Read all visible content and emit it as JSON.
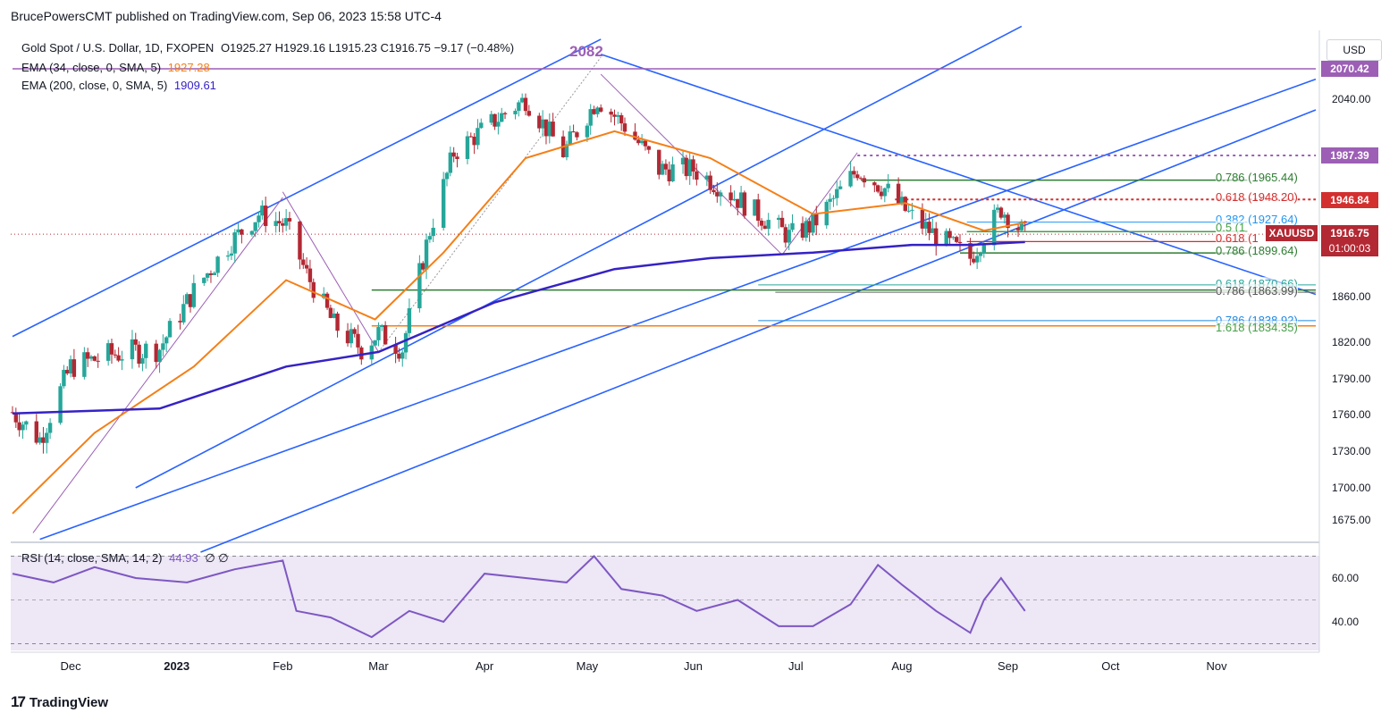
{
  "header": {
    "publisher_line": "BrucePowersCMT published on TradingView.com, Sep 06, 2023 15:58 UTC-4"
  },
  "legend": {
    "symbol": "Gold Spot / U.S. Dollar, 1D, FXOPEN",
    "ohlc": "O1925.27  H1929.16  L1915.23  C1916.75  −9.17 (−0.48%)",
    "ema34_label": "EMA (34, close, 0, SMA, 5)",
    "ema34_value": "1927.28",
    "ema200_label": "EMA (200, close, 0, SMA, 5)",
    "ema200_value": "1909.61",
    "rsi_label": "RSI (14, close, SMA, 14, 2)",
    "rsi_value": "44.93",
    "rsi_extra": "∅ ∅"
  },
  "peak_label": "2082",
  "currency": "USD",
  "price_tags": {
    "resistance_high": "2070.42",
    "dotted_high": "1987.39",
    "red_level": "1946.84",
    "last_price": "1916.75",
    "symbol": "XAUUSD",
    "countdown": "01:00:03"
  },
  "fib_labels": {
    "f1": "0.786 (1965.44)",
    "f2": "0.618 (1948.20)",
    "f3": "0.382 (1927.64)",
    "f4": "0.5 (1",
    "f5": "0.618 (1",
    "f6": "0.786 (1899.64)",
    "f7": "0.618 (1870.66)",
    "f8": "0.786 (1863.99)",
    "f9": "0.786 (1838.92)",
    "f10": "1.618 (1834.35)"
  },
  "footer": {
    "brand": "TradingView",
    "logo": "17"
  },
  "colors": {
    "up": "#26a69a",
    "down": "#b22833",
    "ema34": "#f57f17",
    "ema200": "#3522c4",
    "trendline": "#2962ff",
    "purple": "#9c5fb5",
    "rsi": "#7e57c2",
    "red": "#d32f2f"
  },
  "chart_data": {
    "type": "candlestick",
    "ylabel": "USD",
    "yticks": [
      2040,
      1860,
      1820,
      1790,
      1760,
      1730,
      1700,
      1675
    ],
    "yticks_label": [
      "2040.00",
      "1860.00",
      "1820.00",
      "1790.00",
      "1760.00",
      "1730.00",
      "1700.00",
      "1675.00"
    ],
    "ylim": [
      1650,
      2100
    ],
    "months": [
      "Dec",
      "2023",
      "Feb",
      "Mar",
      "Apr",
      "May",
      "Jun",
      "Jul",
      "Aug",
      "Sep",
      "Oct",
      "Nov"
    ],
    "month_dates": [
      "2022-12-01",
      "2023-01-01",
      "2023-02-01",
      "2023-03-01",
      "2023-04-01",
      "2023-05-01",
      "2023-06-01",
      "2023-07-01",
      "2023-08-01",
      "2023-09-01",
      "2023-10-01",
      "2023-11-01"
    ],
    "close_series": {
      "dates": [
        "2022-11-14",
        "2022-11-22",
        "2022-12-01",
        "2022-12-13",
        "2022-12-27",
        "2023-01-06",
        "2023-01-17",
        "2023-01-25",
        "2023-02-02",
        "2023-02-08",
        "2023-02-16",
        "2023-02-24",
        "2023-03-01",
        "2023-03-08",
        "2023-03-16",
        "2023-03-23",
        "2023-04-04",
        "2023-04-13",
        "2023-04-24",
        "2023-05-04",
        "2023-05-12",
        "2023-05-22",
        "2023-06-01",
        "2023-06-09",
        "2023-06-20",
        "2023-06-29",
        "2023-07-06",
        "2023-07-19",
        "2023-07-27",
        "2023-08-03",
        "2023-08-11",
        "2023-08-21",
        "2023-08-30",
        "2023-09-06"
      ],
      "values": [
        1762,
        1740,
        1800,
        1810,
        1815,
        1865,
        1910,
        1935,
        1925,
        1880,
        1835,
        1815,
        1828,
        1815,
        1920,
        1990,
        2020,
        2040,
        1990,
        2040,
        2015,
        1975,
        1975,
        1960,
        1935,
        1915,
        1925,
        1975,
        1958,
        1935,
        1915,
        1895,
        1940,
        1916.75
      ]
    },
    "ema34": {
      "dates": [
        "2022-11-14",
        "2022-12-08",
        "2023-01-06",
        "2023-02-02",
        "2023-02-28",
        "2023-03-20",
        "2023-04-13",
        "2023-05-09",
        "2023-06-06",
        "2023-07-06",
        "2023-08-02",
        "2023-08-25",
        "2023-09-06"
      ],
      "values": [
        1680,
        1745,
        1800,
        1875,
        1840,
        1900,
        1985,
        2010,
        1985,
        1935,
        1945,
        1920,
        1927.28
      ]
    },
    "ema200": {
      "dates": [
        "2022-11-14",
        "2022-12-27",
        "2023-02-02",
        "2023-03-01",
        "2023-04-04",
        "2023-05-09",
        "2023-06-06",
        "2023-07-06",
        "2023-08-04",
        "2023-08-21",
        "2023-09-06"
      ],
      "values": [
        1761,
        1765,
        1800,
        1812,
        1855,
        1885,
        1895,
        1900,
        1907,
        1907,
        1909.61
      ]
    },
    "horizontal_levels": [
      2070.42,
      1987.39,
      1965.44,
      1948.2,
      1946.84,
      1927.64,
      1919,
      1910,
      1899.64,
      1870.66,
      1866,
      1863.99,
      1838.92,
      1834.35
    ],
    "rsi": {
      "yticks": [
        60,
        40
      ],
      "yticks_label": [
        "60.00",
        "40.00"
      ],
      "band": [
        30,
        70
      ],
      "mid": 50,
      "dates": [
        "2022-11-14",
        "2022-11-26",
        "2022-12-08",
        "2022-12-20",
        "2023-01-04",
        "2023-01-18",
        "2023-02-01",
        "2023-02-05",
        "2023-02-15",
        "2023-02-27",
        "2023-03-10",
        "2023-03-20",
        "2023-04-01",
        "2023-04-13",
        "2023-04-25",
        "2023-05-03",
        "2023-05-11",
        "2023-05-23",
        "2023-06-02",
        "2023-06-14",
        "2023-06-26",
        "2023-07-06",
        "2023-07-17",
        "2023-07-25",
        "2023-08-01",
        "2023-08-11",
        "2023-08-21",
        "2023-08-25",
        "2023-08-30",
        "2023-09-06"
      ],
      "values": [
        62,
        58,
        65,
        60,
        58,
        64,
        68,
        45,
        42,
        33,
        45,
        40,
        62,
        60,
        58,
        70,
        55,
        52,
        45,
        50,
        38,
        38,
        48,
        66,
        57,
        45,
        35,
        50,
        60,
        44.93
      ]
    }
  }
}
